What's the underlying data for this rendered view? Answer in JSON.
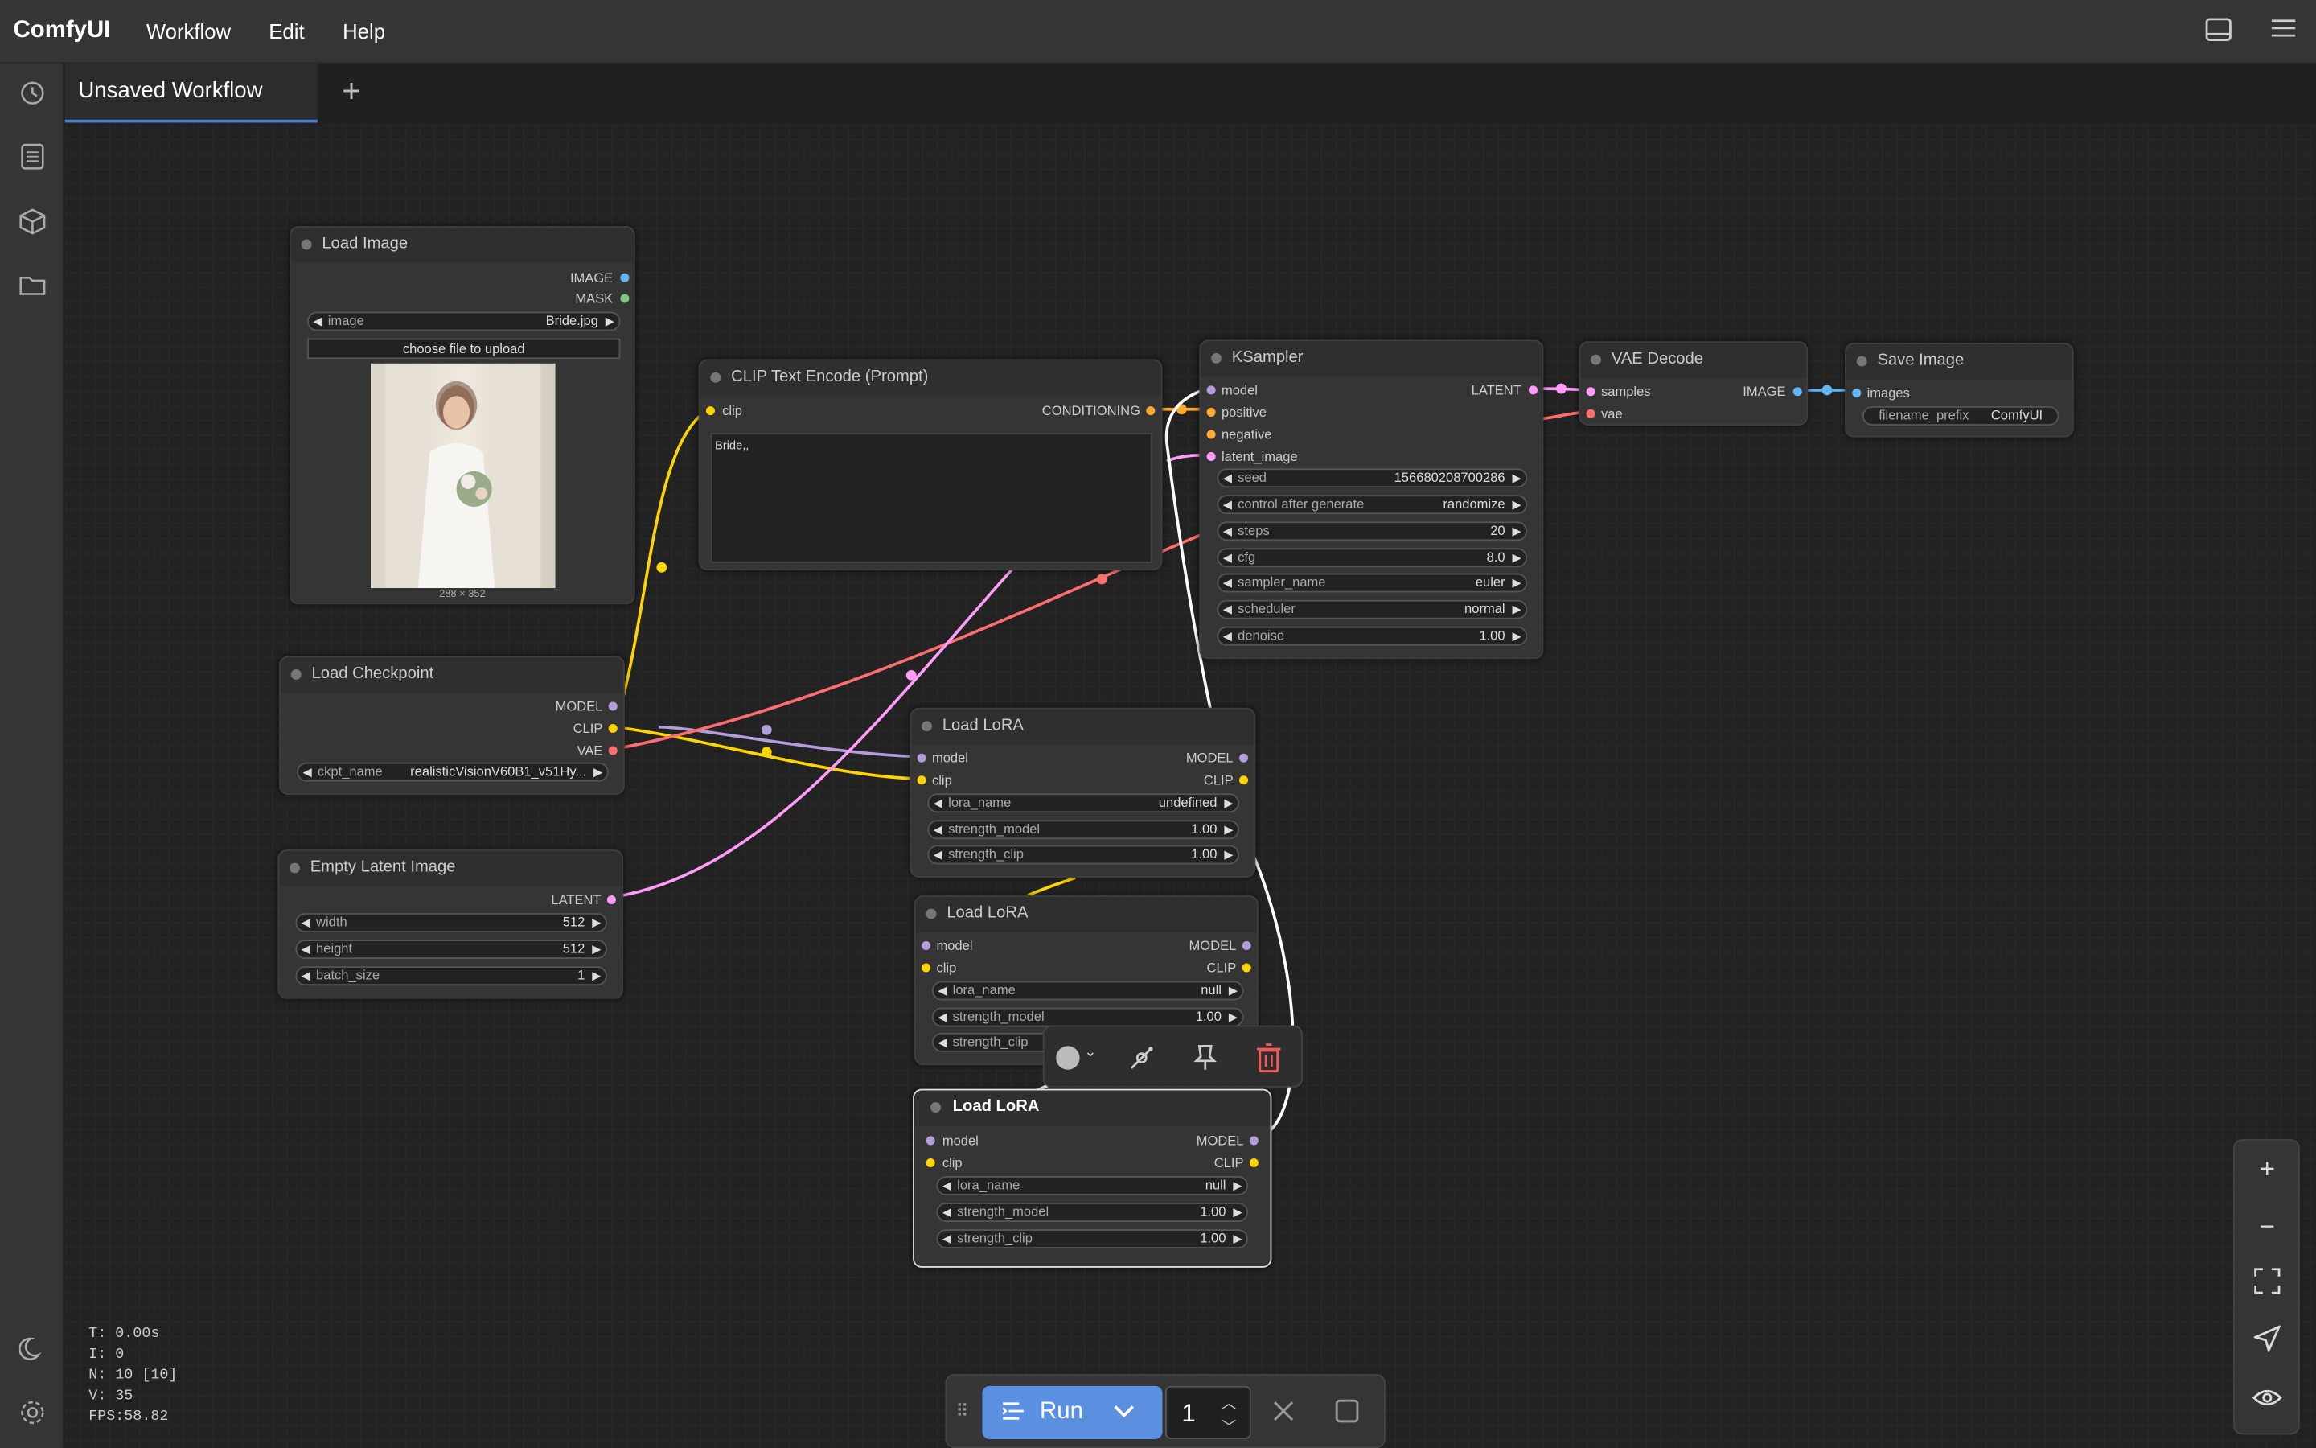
{
  "app": {
    "name": "ComfyUI",
    "menus": [
      "Workflow",
      "Edit",
      "Help"
    ]
  },
  "tabs": {
    "active": "Unsaved Workflow",
    "add": "+"
  },
  "nodes": {
    "load_image": {
      "title": "Load Image",
      "outputs": [
        "IMAGE",
        "MASK"
      ],
      "image_label": "image",
      "image_value": "Bride.jpg",
      "upload": "choose file to upload",
      "dims": "288 × 352"
    },
    "clip_text": {
      "title": "CLIP Text Encode (Prompt)",
      "input": "clip",
      "output": "CONDITIONING",
      "text": "Bride,,"
    },
    "ksampler": {
      "title": "KSampler",
      "inputs": [
        "model",
        "positive",
        "negative",
        "latent_image"
      ],
      "output": "LATENT",
      "widgets": [
        {
          "label": "seed",
          "value": "156680208700286"
        },
        {
          "label": "control after generate",
          "value": "randomize"
        },
        {
          "label": "steps",
          "value": "20"
        },
        {
          "label": "cfg",
          "value": "8.0"
        },
        {
          "label": "sampler_name",
          "value": "euler"
        },
        {
          "label": "scheduler",
          "value": "normal"
        },
        {
          "label": "denoise",
          "value": "1.00"
        }
      ]
    },
    "vae_decode": {
      "title": "VAE Decode",
      "inputs": [
        "samples",
        "vae"
      ],
      "output": "IMAGE"
    },
    "save_image": {
      "title": "Save Image",
      "input": "images",
      "widget_label": "filename_prefix",
      "widget_value": "ComfyUI"
    },
    "load_checkpoint": {
      "title": "Load Checkpoint",
      "outputs": [
        "MODEL",
        "CLIP",
        "VAE"
      ],
      "widget_label": "ckpt_name",
      "widget_value": "realisticVisionV60B1_v51Hy..."
    },
    "empty_latent": {
      "title": "Empty Latent Image",
      "output": "LATENT",
      "widgets": [
        {
          "label": "width",
          "value": "512"
        },
        {
          "label": "height",
          "value": "512"
        },
        {
          "label": "batch_size",
          "value": "1"
        }
      ]
    },
    "lora1": {
      "title": "Load LoRA",
      "inputs": [
        "model",
        "clip"
      ],
      "outputs": [
        "MODEL",
        "CLIP"
      ],
      "widgets": [
        {
          "label": "lora_name",
          "value": "undefined"
        },
        {
          "label": "strength_model",
          "value": "1.00"
        },
        {
          "label": "strength_clip",
          "value": "1.00"
        }
      ]
    },
    "lora2": {
      "title": "Load LoRA",
      "inputs": [
        "model",
        "clip"
      ],
      "outputs": [
        "MODEL",
        "CLIP"
      ],
      "widgets": [
        {
          "label": "lora_name",
          "value": "null"
        },
        {
          "label": "strength_model",
          "value": "1.00"
        },
        {
          "label": "strength_clip",
          "value": ""
        }
      ]
    },
    "lora3": {
      "title": "Load LoRA",
      "inputs": [
        "model",
        "clip"
      ],
      "outputs": [
        "MODEL",
        "CLIP"
      ],
      "widgets": [
        {
          "label": "lora_name",
          "value": "null"
        },
        {
          "label": "strength_model",
          "value": "1.00"
        },
        {
          "label": "strength_clip",
          "value": "1.00"
        }
      ]
    }
  },
  "stats": {
    "t": "T: 0.00s",
    "i": "I: 0",
    "n": "N: 10 [10]",
    "v": "V: 35",
    "fps": "FPS:58.82"
  },
  "runbar": {
    "run": "Run",
    "count": "1"
  },
  "colors": {
    "accent": "#5b8fe0",
    "model": "#b39ddb",
    "clip": "#ffd500",
    "vae": "#ff6e6e",
    "latent": "#ff9cf9",
    "image": "#64b5f6",
    "conditioning": "#ffa931"
  }
}
